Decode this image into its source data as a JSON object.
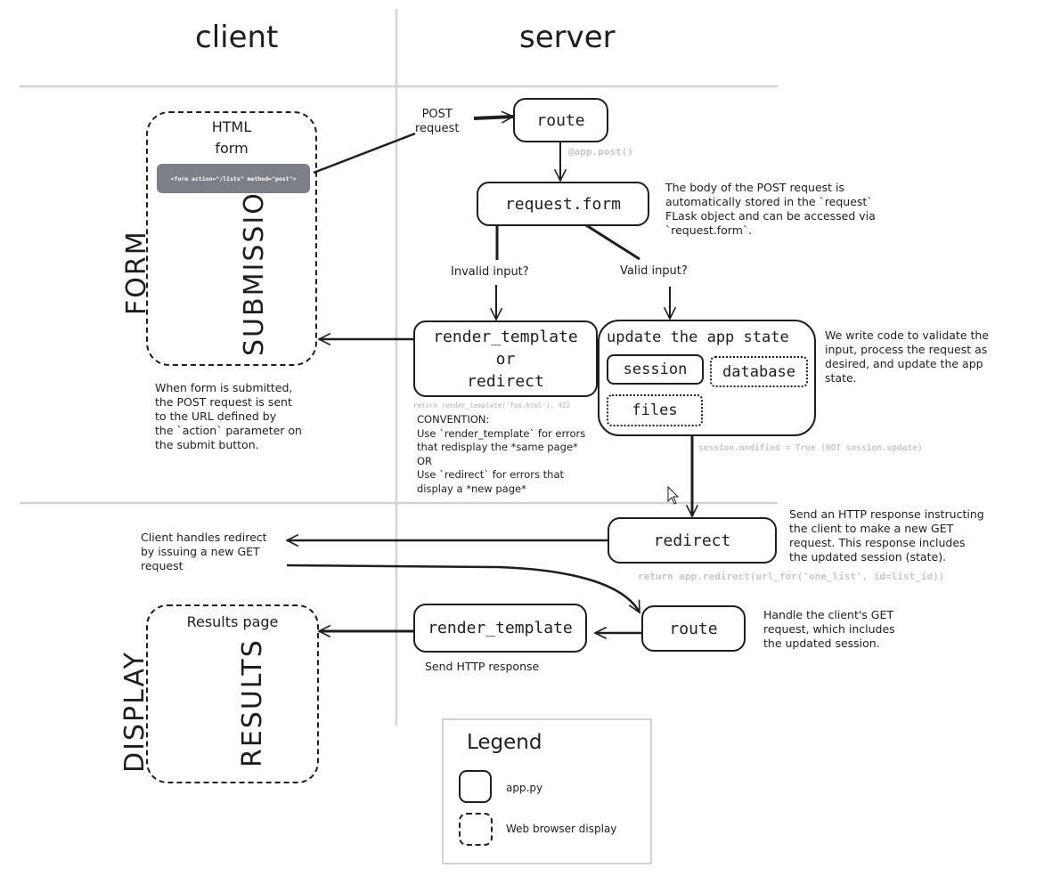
{
  "columns": {
    "client": "client",
    "server": "server"
  },
  "rows": {
    "form_submission": [
      "FORM",
      "SUBMISSION"
    ],
    "display_results": [
      "DISPLAY",
      "RESULTS"
    ]
  },
  "client": {
    "html_form": {
      "title_line1": "HTML",
      "title_line2": "form",
      "code": "<form action=\"/lists\" method=\"post\">"
    },
    "form_note": [
      "When form is submitted,",
      "the POST request is sent",
      "to the URL defined by",
      "the `action` parameter on",
      "the submit button."
    ],
    "redirect_note": [
      "Client handles redirect",
      "by issuing a new GET",
      "request"
    ],
    "results_page": "Results page"
  },
  "server": {
    "post_label": [
      "POST",
      "request"
    ],
    "route_top": "route",
    "route_hint": "@app.post()",
    "request_form": "request.form",
    "request_form_note": [
      "The body of the POST request is",
      "automatically stored in the `request`",
      "FLask object and can be accessed via",
      "`request.form`."
    ],
    "invalid_label": "Invalid input?",
    "valid_label": "Valid input?",
    "render_or_redirect": [
      "render_template",
      "or",
      "redirect"
    ],
    "render_hint": "return render_template('foo.html'), 422",
    "convention": [
      "CONVENTION:",
      "Use `render_template` for errors",
      "that redisplay the *same page*",
      "OR",
      "Use `redirect` for errors that",
      "display a *new page*"
    ],
    "update_state": {
      "title": "update the app state",
      "session": "session",
      "database": "database",
      "files": "files"
    },
    "update_note": [
      "We write code to validate the",
      "input, process the request as",
      "desired, and update the app",
      "state."
    ],
    "session_hint": "session.modified = True (NOT session.update)",
    "redirect": "redirect",
    "redirect_note": [
      "Send an HTTP response instructing",
      "the client to make a new GET",
      "request.  This response includes",
      "the updated session (state)."
    ],
    "redirect_hint": "return app.redirect(url_for('one_list', id=list_id))",
    "route_bottom": "route",
    "route_bottom_note": [
      "Handle the client's GET",
      "request, which includes",
      "the updated session."
    ],
    "render_template": "render_template",
    "render_template_note": "Send HTTP response"
  },
  "legend": {
    "title": "Legend",
    "items": [
      {
        "style": "solid",
        "label": "app.py"
      },
      {
        "style": "dashed",
        "label": "Web browser display"
      }
    ]
  }
}
